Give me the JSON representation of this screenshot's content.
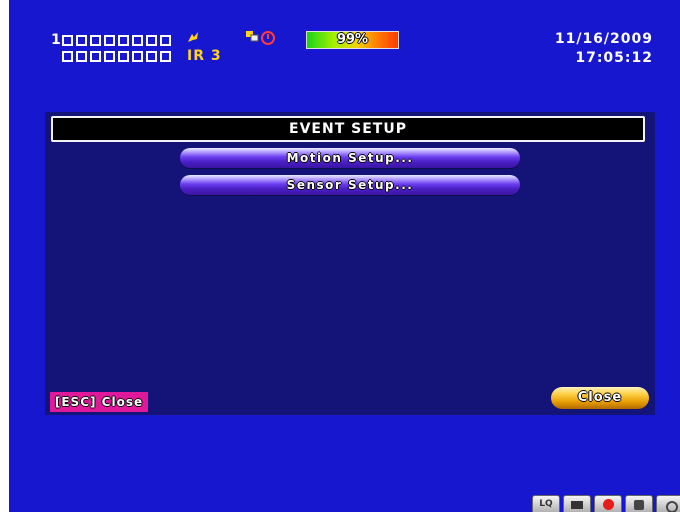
{
  "status": {
    "channel_rows": [
      {
        "number": "1",
        "boxes": 8
      },
      {
        "number": "",
        "boxes": 8
      }
    ],
    "ir_label": "IR 3",
    "hdd_icon": "hdd-icon",
    "network_icon": "network-icon",
    "schedule_icon": "clock-icon",
    "hdd_percent": "99%",
    "date": "11/16/2009",
    "time": "17:05:12"
  },
  "dialog": {
    "title": "EVENT SETUP",
    "items": [
      {
        "label": "Motion Setup..."
      },
      {
        "label": "Sensor Setup..."
      }
    ],
    "esc_hint": "[ESC] Close",
    "close_label": "Close"
  },
  "toolbar": {
    "buttons": [
      {
        "name": "lq-button",
        "label": "LQ"
      },
      {
        "name": "monitor-button",
        "icon": "monitor-icon"
      },
      {
        "name": "record-button",
        "icon": "record-icon"
      },
      {
        "name": "ptz-button",
        "icon": "ptz-icon"
      },
      {
        "name": "key-button",
        "icon": "key-icon"
      }
    ]
  },
  "colors": {
    "background": "#1717cf",
    "panel": "#141478",
    "accent_yellow": "#ffd21c",
    "esc_label": "#e0199a"
  }
}
